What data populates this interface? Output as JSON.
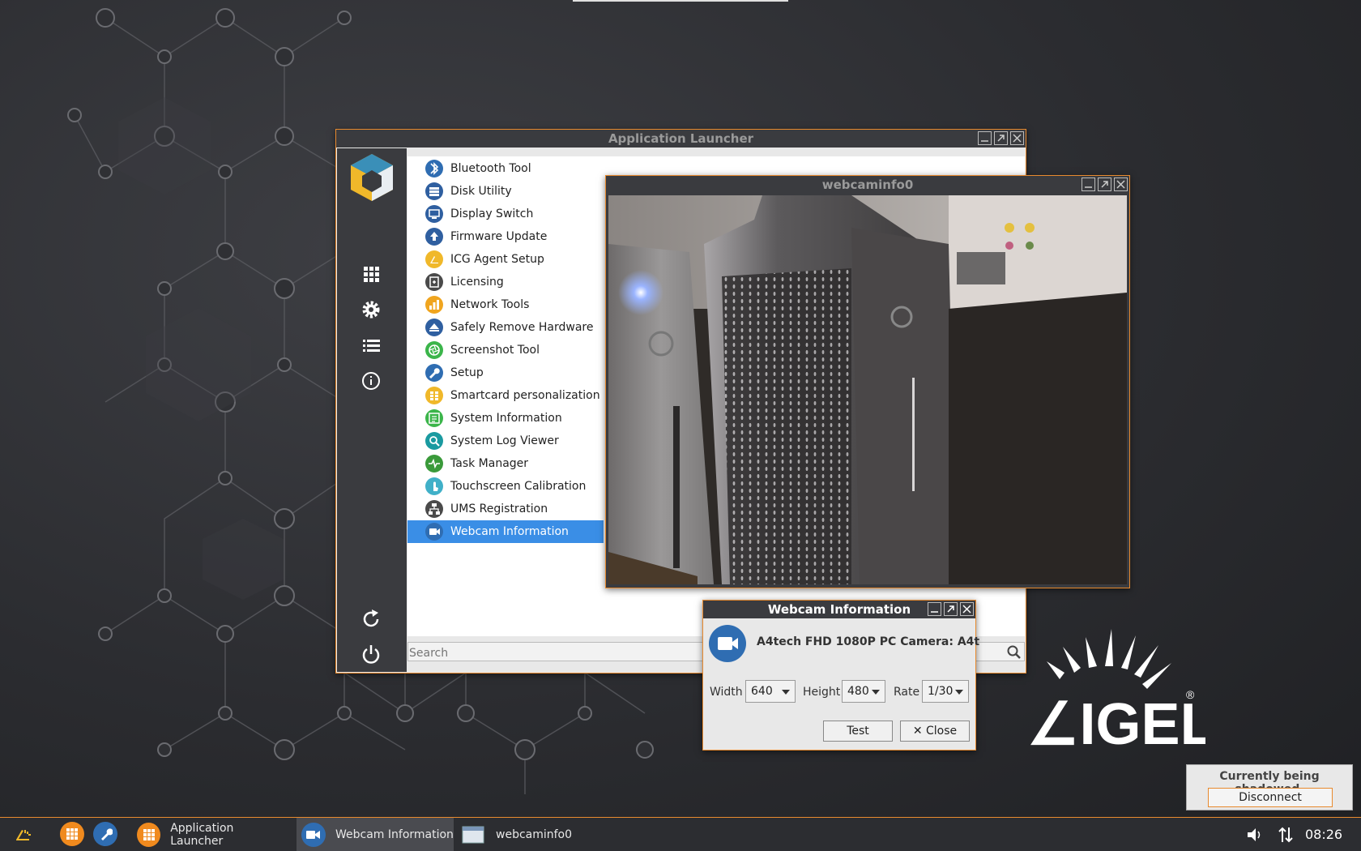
{
  "launcher": {
    "title": "Application Launcher",
    "items": [
      {
        "label": "Bluetooth Tool",
        "color": "#2f6db2",
        "icon": "bluetooth-icon"
      },
      {
        "label": "Disk Utility",
        "color": "#2f5fa0",
        "icon": "disk-icon"
      },
      {
        "label": "Display Switch",
        "color": "#2f5fa0",
        "icon": "display-icon"
      },
      {
        "label": "Firmware Update",
        "color": "#2f5fa0",
        "icon": "upload-icon"
      },
      {
        "label": "ICG Agent Setup",
        "color": "#f0b82a",
        "icon": "igel-icon"
      },
      {
        "label": "Licensing",
        "color": "#4a4a4a",
        "icon": "license-icon"
      },
      {
        "label": "Network Tools",
        "color": "#f0a51f",
        "icon": "network-icon"
      },
      {
        "label": "Safely Remove Hardware",
        "color": "#2f5fa0",
        "icon": "eject-icon"
      },
      {
        "label": "Screenshot Tool",
        "color": "#3bb54a",
        "icon": "aperture-icon"
      },
      {
        "label": "Setup",
        "color": "#2f6db2",
        "icon": "wrench-icon"
      },
      {
        "label": "Smartcard personalization",
        "color": "#f0b82a",
        "icon": "smartcard-icon"
      },
      {
        "label": "System Information",
        "color": "#3bb54a",
        "icon": "sysinfo-icon"
      },
      {
        "label": "System Log Viewer",
        "color": "#1a9aa0",
        "icon": "search-icon"
      },
      {
        "label": "Task Manager",
        "color": "#3a9a3a",
        "icon": "heartbeat-icon"
      },
      {
        "label": "Touchscreen Calibration",
        "color": "#40b0c8",
        "icon": "touch-icon"
      },
      {
        "label": "UMS Registration",
        "color": "#4a4a4a",
        "icon": "ums-icon"
      },
      {
        "label": "Webcam Information",
        "color": "#2f6db2",
        "icon": "webcam-icon"
      }
    ],
    "selected_index": 16,
    "search_placeholder": "Search"
  },
  "webcam_window": {
    "title": "webcaminfo0"
  },
  "info_dialog": {
    "title": "Webcam Information",
    "camera_name": "A4tech FHD 1080P PC Camera: A4t",
    "width_label": "Width",
    "width_value": "640",
    "height_label": "Height",
    "height_value": "480",
    "rate_label": "Rate",
    "rate_value": "1/30",
    "test_label": "Test",
    "close_label": "✕ Close"
  },
  "taskbar": {
    "tasks": [
      "Application Launcher",
      "Webcam Information",
      "webcaminfo0"
    ],
    "clock": "08:26"
  },
  "shadow": {
    "message": "Currently being shadowed.",
    "button": "Disconnect"
  },
  "colors": {
    "accent": "#e88a2e",
    "selection": "#3a8ee6",
    "igel_yellow": "#f0b82a"
  }
}
